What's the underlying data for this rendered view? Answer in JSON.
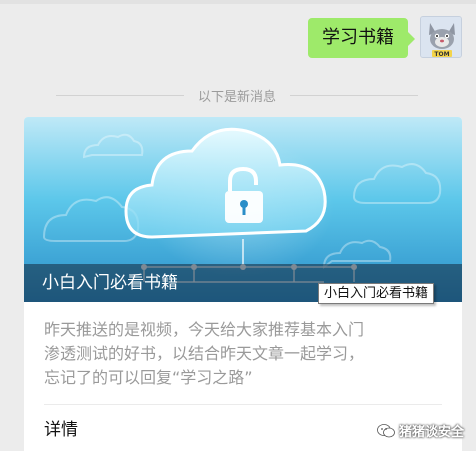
{
  "chat": {
    "outgoing_message": "学习书籍",
    "avatar_caption": "TOM",
    "new_messages_divider": "以下是新消息"
  },
  "article": {
    "cover_title": "小白入门必看书籍",
    "tooltip": "小白入门必看书籍",
    "digest_lines": [
      "昨天推送的是视频，今天给大家推荐基本入门",
      "渗透测试的好书，以结合昨天文章一起学习，",
      "忘记了的可以回复“学习之路”"
    ],
    "details_label": "详情"
  },
  "watermark": {
    "text": "猪猪谈安全",
    "icon": "wechat-icon"
  },
  "colors": {
    "chat_background": "#ececec",
    "outgoing_bubble": "#9eea6a",
    "digest_text": "#9a9a9a"
  }
}
